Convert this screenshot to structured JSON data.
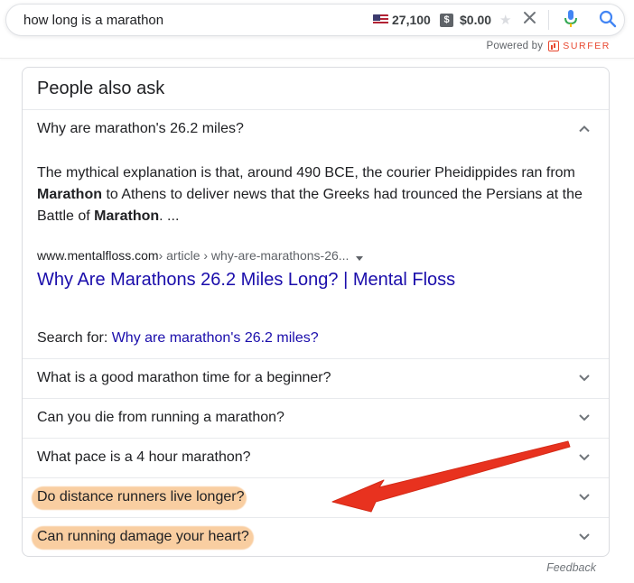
{
  "search": {
    "query": "how long is a marathon",
    "volume": "27,100",
    "currency_badge": "$",
    "cpc": "$0.00",
    "powered_by": "Powered by",
    "brand": "SURFER"
  },
  "paa": {
    "title": "People also ask",
    "expanded": {
      "question": "Why are marathon's 26.2 miles?",
      "answer_parts": [
        "The mythical explanation is that, around 490 BCE, the courier Pheidippides ran from ",
        "Marathon",
        " to Athens to deliver news that the Greeks had trounced the Persians at the Battle of ",
        "Marathon",
        ". ..."
      ],
      "source_domain": "www.mentalfloss.com",
      "source_path": " › article › why-are-marathons-26...",
      "result_title": "Why Are Marathons 26.2 Miles Long? | Mental Floss",
      "search_for_label": "Search for: ",
      "search_for_query": "Why are marathon's 26.2 miles?"
    },
    "questions": [
      "What is a good marathon time for a beginner?",
      "Can you die from running a marathon?",
      "What pace is a 4 hour marathon?",
      "Do distance runners live longer?",
      "Can running damage your heart?"
    ],
    "highlighted_questions": [
      3,
      4
    ],
    "feedback": "Feedback"
  },
  "colors": {
    "link": "#1a0dab",
    "highlight": "#f7be82",
    "arrow": "#e8321f",
    "mic_blue": "#4285f4",
    "mic_red": "#ea4335"
  }
}
